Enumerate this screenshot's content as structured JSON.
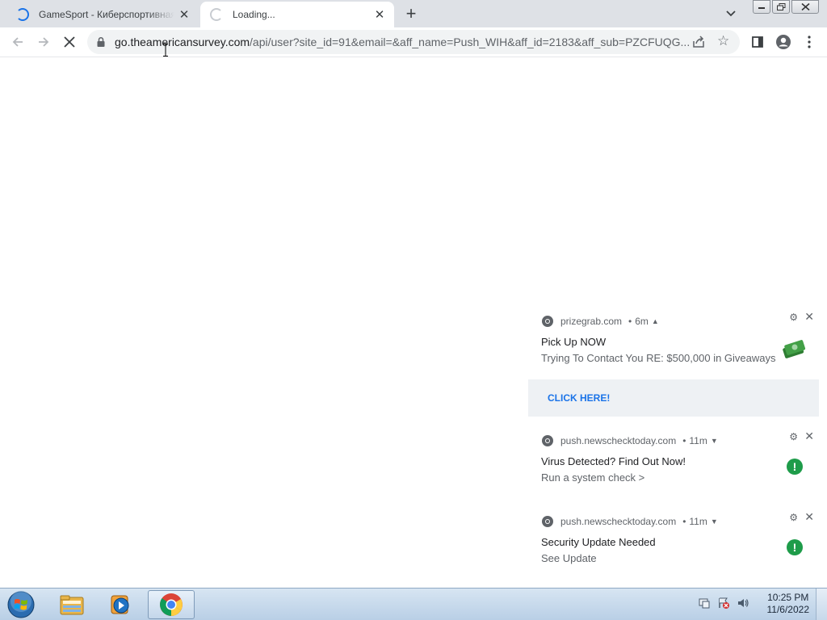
{
  "browser": {
    "tabs": [
      {
        "title": "GameSport - Киберспортивная",
        "close": "✕"
      },
      {
        "title": "Loading...",
        "close": "✕"
      }
    ],
    "new_tab": "+",
    "omnibox": {
      "url_host": "go.theamericansurvey.com",
      "url_rest": "/api/user?site_id=91&email=&aff_name=Push_WIH&aff_id=2183&aff_sub=PZCFUQG..."
    },
    "icons": {
      "back": "back-arrow-icon",
      "forward": "forward-arrow-icon",
      "stop": "stop-loading-icon",
      "lock": "lock-icon",
      "share": "share-icon",
      "star": "bookmark-star-icon",
      "side_panel": "side-panel-icon",
      "profile": "profile-icon",
      "menu": "kebab-menu-icon"
    }
  },
  "notifications": [
    {
      "origin": "prizegrab.com",
      "age": "6m",
      "title": "Pick Up NOW",
      "body": "Trying To Contact You RE: $500,000 in Giveaways",
      "action": "CLICK HERE!",
      "image": "money-icon"
    },
    {
      "origin": "push.newschecktoday.com",
      "age": "11m",
      "title": "Virus Detected? Find Out Now!",
      "body": "Run a system check >",
      "image": "green-alert-icon"
    },
    {
      "origin": "push.newschecktoday.com",
      "age": "11m",
      "title": "Security Update Needed",
      "body": "See Update",
      "image": "green-alert-icon"
    }
  ],
  "taskbar": {
    "clock_time": "10:25 PM",
    "clock_date": "11/6/2022",
    "items": [
      "start-orb-icon",
      "file-explorer-icon",
      "media-player-icon",
      "chrome-icon"
    ]
  },
  "colors": {
    "accent": "#1a73e8",
    "tabstrip": "#dee1e6",
    "notification_badge": "#1e9c4a"
  }
}
